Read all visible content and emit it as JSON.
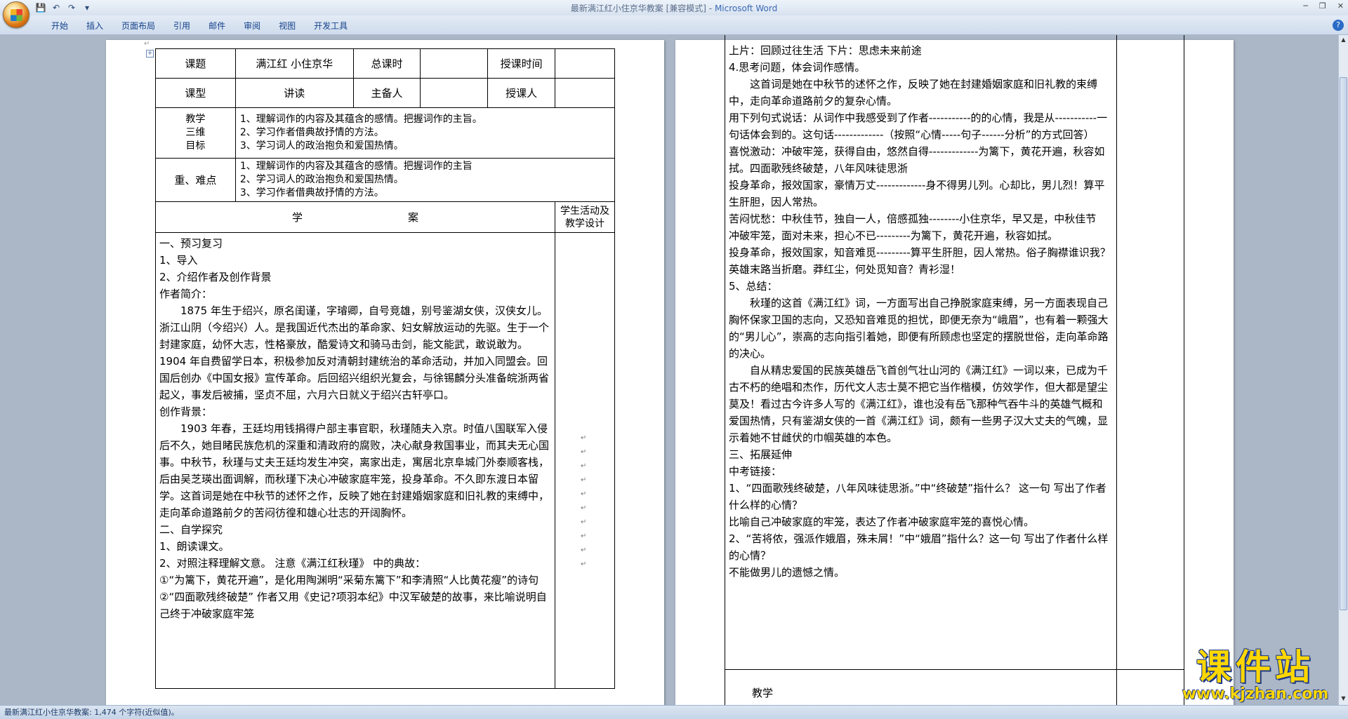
{
  "window": {
    "title": "最新满江红小住京华教案 [兼容模式]",
    "app": "Microsoft Word",
    "title_sep": " - "
  },
  "ribbon": {
    "tabs": [
      "开始",
      "插入",
      "页面布局",
      "引用",
      "邮件",
      "审阅",
      "视图",
      "开发工具"
    ]
  },
  "status": {
    "text": "最新满江红小住京华教案: 1,474 个字符(近似值)。"
  },
  "header_table": {
    "row1": {
      "topic_label": "课题",
      "topic_value": "满江红 小住京华",
      "hours_label": "总课时",
      "hours_value": "",
      "time_label": "授课时间",
      "time_value": ""
    },
    "row2": {
      "type_label": "课型",
      "type_value": "讲读",
      "prep_label": "主备人",
      "prep_value": "",
      "teacher_label": "授课人",
      "teacher_value": ""
    },
    "goals_label_1": "教学",
    "goals_label_2": "三维",
    "goals_label_3": "目标",
    "goals": [
      "1、理解词作的内容及其蕴含的感情。把握词作的主旨。",
      "2、学习作者借典故抒情的方法。",
      "3、学习词人的政治抱负和爱国热情。"
    ],
    "key_label": "重、难点",
    "keys": [
      "1、理解词作的内容及其蕴含的感情。把握词作的主旨",
      "2、学习词人的政治抱负和爱国热情。",
      "3、学习作者借典故抒情的方法。"
    ],
    "xue": "学",
    "an": "案",
    "side_header": "学生活动及教学设计"
  },
  "left_body": [
    {
      "t": "一、预习复习",
      "ind": false
    },
    {
      "t": "1、导入",
      "ind": false
    },
    {
      "t": "2、介绍作者及创作背景",
      "ind": false
    },
    {
      "t": "作者简介：",
      "ind": false
    },
    {
      "t": "1875 年生于绍兴，原名闺谨，字璿卿，自号竞雄，别号鉴湖女侠，汉侠女儿。浙江山阴（今绍兴）人。是我国近代杰出的革命家、妇女解放运动的先驱。生于一个封建家庭，幼怀大志，性格豪放，酷爱诗文和骑马击剑，能文能武，敢说敢为。1904 年自费留学日本，积极参加反对清朝封建统治的革命活动，并加入同盟会。回国后创办《中国女报》宣传革命。后回绍兴组织光复会，与徐锡麟分头准备皖浙两省起义，事发后被捕，坚贞不屈，六月六日就义于绍兴古轩亭口。",
      "ind": true
    },
    {
      "t": "创作背景：",
      "ind": false
    },
    {
      "t": "1903 年春，王廷均用钱捐得户部主事官职，秋瑾随夫入京。时值八国联军入侵后不久，她目睹民族危机的深重和清政府的腐败，决心献身救国事业，而其夫无心国事。中秋节，秋瑾与丈夫王廷均发生冲突，离家出走，寓居北京阜城门外泰顺客栈，后由吴芝瑛出面调解，而秋瑾下决心冲破家庭牢笼，投身革命。不久即东渡日本留学。这首词是她在中秋节的述怀之作，反映了她在封建婚姻家庭和旧礼教的束缚中，走向革命道路前夕的苦闷彷徨和雄心壮志的开阔胸怀。",
      "ind": true
    },
    {
      "t": "二、自学探究",
      "ind": false
    },
    {
      "t": "1、朗读课文。",
      "ind": false
    },
    {
      "t": "2、对照注释理解文意。      注意《满江红秋瑾》 中的典故：",
      "ind": false
    },
    {
      "t": "①“为篱下，黄花开遍”，是化用陶渊明“采菊东篱下”和李清照“人比黄花瘦”的诗句",
      "ind": false
    },
    {
      "t": "②“四面歌残终破楚” 作者又用《史记?项羽本纪》中汉军破楚的故事，来比喻说明自己终于冲破家庭牢笼",
      "ind": false
    }
  ],
  "right_body": [
    {
      "t": "上片：回顾过往生活          下片：思虑未来前途",
      "ind": false
    },
    {
      "t": "4.思考问题，体会词作感情。",
      "ind": false
    },
    {
      "t": "这首词是她在中秋节的述怀之作，反映了她在封建婚姻家庭和旧礼教的束缚中，走向革命道路前夕的复杂心情。",
      "ind": true
    },
    {
      "t": "用下列句式说话：从词作中我感受到了作者-----------的的心情，我是从-----------一句话体会到的。这句话-------------（按照“心情-----句子------分析”的方式回答）",
      "ind": false
    },
    {
      "t": "喜悦激动：冲破牢笼，获得自由，悠然自得-------------为篱下，黄花开遍，秋容如拭。四面歌残终破楚，八年风味徒思浙",
      "ind": false
    },
    {
      "t": "投身革命，报效国家，豪情万丈-------------身不得男儿列。心却比，男儿烈！算平生肝胆，因人常热。",
      "ind": false
    },
    {
      "t": "苦闷忧愁：中秋佳节，独自一人，倍感孤独--------小住京华，早又是，中秋佳节",
      "ind": false
    },
    {
      "t": "冲破牢笼，面对未来，担心不已---------为篱下，黄花开遍，秋容如拭。",
      "ind": false
    },
    {
      "t": "投身革命，报效国家，知音难觅---------算平生肝胆，因人常热。俗子胸襟谁识我？英雄末路当折磨。莽红尘，何处觅知音？青衫湿！",
      "ind": false
    },
    {
      "t": "5、总结：",
      "ind": false
    },
    {
      "t": "秋瑾的这首《满江红》词，一方面写出自己挣脱家庭束缚，另一方面表现自己胸怀保家卫国的志向，又恐知音难觅的担忧，即便无奈为“峨眉”，也有着一颗强大的“男儿心”，崇高的志向指引着她，即便有所顾虑也坚定的摆脱世俗，走向革命路的决心。",
      "ind": true
    },
    {
      "t": "自从精忠爱国的民族英雄岳飞首创气壮山河的《满江红》一词以来，已成为千古不朽的绝唱和杰作，历代文人志士莫不把它当作楷模，仿效学作，但大都是望尘莫及！看过古今许多人写的《满江红》，谁也没有岳飞那种气吞牛斗的英雄气概和爱国热情，只有鉴湖女侠的一首《满江红》词，颇有一些男子汉大丈夫的气魄，显示着她不甘雌伏的巾帼英雄的本色。",
      "ind": true
    },
    {
      "t": "三、拓展延伸",
      "ind": false
    },
    {
      "t": "中考链接：",
      "ind": false
    },
    {
      "t": "1、“四面歌残终破楚，八年风味徒思浙。”中“终破楚”指什么？ 这一句 写出了作者什么样的心情？",
      "ind": false
    },
    {
      "t": "比喻自己冲破家庭的牢笼，表达了作者冲破家庭牢笼的喜悦心情。",
      "ind": false
    },
    {
      "t": "2、“苦将侬，强派作娥眉，殊未屑！”中“娥眉”指什么？这一句 写出了作者什么样的心情？",
      "ind": false
    },
    {
      "t": "不能做男儿的遗憾之情。",
      "ind": false
    }
  ],
  "right_footer_label": "教学",
  "watermark": {
    "big": "课件站",
    "url": "www.kjzhan.com"
  }
}
